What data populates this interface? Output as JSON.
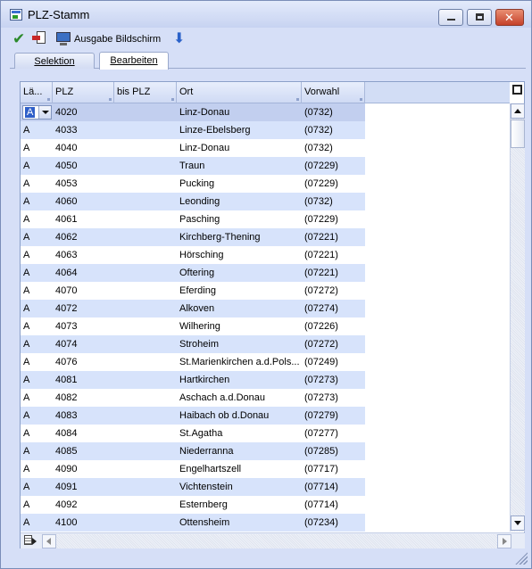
{
  "window": {
    "title": "PLZ-Stamm"
  },
  "toolbar": {
    "check_icon": "check-icon",
    "export_icon": "export-icon",
    "monitor_icon": "monitor-icon",
    "output_label": "Ausgabe Bildschirm",
    "down_icon": "down-arrow-icon"
  },
  "tabs": [
    {
      "label": "Selektion",
      "active": false
    },
    {
      "label": "Bearbeiten",
      "active": true
    }
  ],
  "grid": {
    "columns": [
      "Lä...",
      "PLZ",
      "bis PLZ",
      "Ort",
      "Vorwahl"
    ],
    "rows": [
      {
        "land": "A",
        "plz": "4020",
        "bis": "",
        "ort": "Linz-Donau",
        "vorwahl": "(0732)"
      },
      {
        "land": "A",
        "plz": "4033",
        "bis": "",
        "ort": "Linze-Ebelsberg",
        "vorwahl": "(0732)"
      },
      {
        "land": "A",
        "plz": "4040",
        "bis": "",
        "ort": "Linz-Donau",
        "vorwahl": "(0732)"
      },
      {
        "land": "A",
        "plz": "4050",
        "bis": "",
        "ort": "Traun",
        "vorwahl": "(07229)"
      },
      {
        "land": "A",
        "plz": "4053",
        "bis": "",
        "ort": "Pucking",
        "vorwahl": "(07229)"
      },
      {
        "land": "A",
        "plz": "4060",
        "bis": "",
        "ort": "Leonding",
        "vorwahl": "(0732)"
      },
      {
        "land": "A",
        "plz": "4061",
        "bis": "",
        "ort": "Pasching",
        "vorwahl": "(07229)"
      },
      {
        "land": "A",
        "plz": "4062",
        "bis": "",
        "ort": "Kirchberg-Thening",
        "vorwahl": "(07221)"
      },
      {
        "land": "A",
        "plz": "4063",
        "bis": "",
        "ort": "Hörsching",
        "vorwahl": "(07221)"
      },
      {
        "land": "A",
        "plz": "4064",
        "bis": "",
        "ort": "Oftering",
        "vorwahl": "(07221)"
      },
      {
        "land": "A",
        "plz": "4070",
        "bis": "",
        "ort": "Eferding",
        "vorwahl": "(07272)"
      },
      {
        "land": "A",
        "plz": "4072",
        "bis": "",
        "ort": "Alkoven",
        "vorwahl": "(07274)"
      },
      {
        "land": "A",
        "plz": "4073",
        "bis": "",
        "ort": "Wilhering",
        "vorwahl": "(07226)"
      },
      {
        "land": "A",
        "plz": "4074",
        "bis": "",
        "ort": "Stroheim",
        "vorwahl": "(07272)"
      },
      {
        "land": "A",
        "plz": "4076",
        "bis": "",
        "ort": "St.Marienkirchen a.d.Pols...",
        "vorwahl": "(07249)"
      },
      {
        "land": "A",
        "plz": "4081",
        "bis": "",
        "ort": "Hartkirchen",
        "vorwahl": "(07273)"
      },
      {
        "land": "A",
        "plz": "4082",
        "bis": "",
        "ort": "Aschach a.d.Donau",
        "vorwahl": "(07273)"
      },
      {
        "land": "A",
        "plz": "4083",
        "bis": "",
        "ort": "Haibach ob d.Donau",
        "vorwahl": "(07279)"
      },
      {
        "land": "A",
        "plz": "4084",
        "bis": "",
        "ort": "St.Agatha",
        "vorwahl": "(07277)"
      },
      {
        "land": "A",
        "plz": "4085",
        "bis": "",
        "ort": "Niederranna",
        "vorwahl": "(07285)"
      },
      {
        "land": "A",
        "plz": "4090",
        "bis": "",
        "ort": "Engelhartszell",
        "vorwahl": "(07717)"
      },
      {
        "land": "A",
        "plz": "4091",
        "bis": "",
        "ort": "Vichtenstein",
        "vorwahl": "(07714)"
      },
      {
        "land": "A",
        "plz": "4092",
        "bis": "",
        "ort": "Esternberg",
        "vorwahl": "(07714)"
      },
      {
        "land": "A",
        "plz": "4100",
        "bis": "",
        "ort": "Ottensheim",
        "vorwahl": "(07234)"
      }
    ]
  },
  "colors": {
    "window_bg": "#d6dff7",
    "row_alt": "#d7e3fb",
    "row_selected": "#c2cfef",
    "selection": "#2f5fc8",
    "close_button": "#c5412a"
  }
}
